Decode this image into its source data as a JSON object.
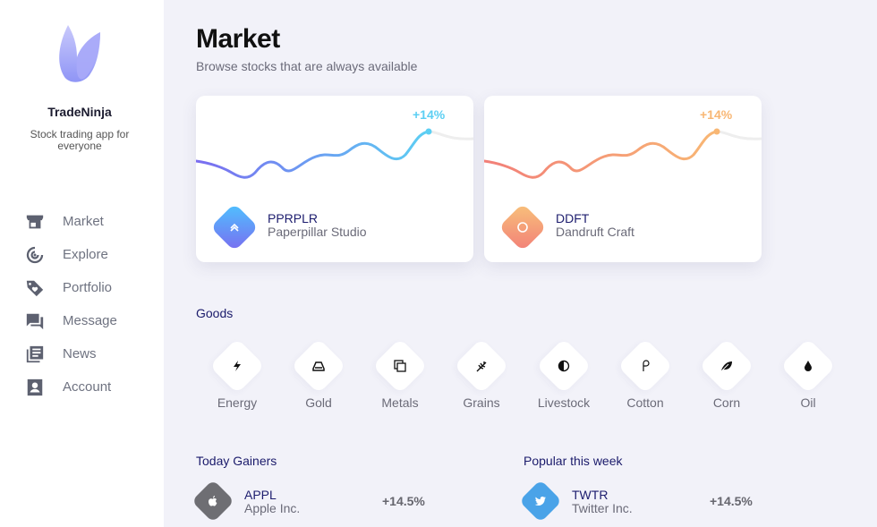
{
  "app": {
    "name": "TradeNinja",
    "tagline": "Stock trading app for everyone"
  },
  "nav": {
    "items": [
      {
        "label": "Market",
        "icon": "store-icon"
      },
      {
        "label": "Explore",
        "icon": "target-icon"
      },
      {
        "label": "Portfolio",
        "icon": "tag-heart-icon"
      },
      {
        "label": "Message",
        "icon": "chat-icon"
      },
      {
        "label": "News",
        "icon": "news-icon"
      },
      {
        "label": "Account",
        "icon": "account-icon"
      }
    ]
  },
  "page": {
    "title": "Market",
    "subtitle": "Browse stocks that are always available"
  },
  "featured": [
    {
      "ticker": "PPRPLR",
      "name": "Paperpillar Studio",
      "change": "+14%",
      "icon": "chevrons-up-icon",
      "colors": [
        "#7a6cf0",
        "#5ccff3"
      ]
    },
    {
      "ticker": "DDFT",
      "name": "Dandruft Craft",
      "change": "+14%",
      "icon": "circle-icon",
      "colors": [
        "#f27f78",
        "#f8b774"
      ]
    }
  ],
  "goods": {
    "title": "Goods",
    "items": [
      {
        "label": "Energy",
        "icon": "lightning-icon"
      },
      {
        "label": "Gold",
        "icon": "ingot-icon"
      },
      {
        "label": "Metals",
        "icon": "copy-icon"
      },
      {
        "label": "Grains",
        "icon": "wheat-icon"
      },
      {
        "label": "Livestock",
        "icon": "half-circle-icon"
      },
      {
        "label": "Cotton",
        "icon": "cotton-icon"
      },
      {
        "label": "Corn",
        "icon": "leaf-icon"
      },
      {
        "label": "Oil",
        "icon": "drop-icon"
      }
    ]
  },
  "gainers": {
    "title": "Today Gainers",
    "items": [
      {
        "ticker": "APPL",
        "name": "Apple Inc.",
        "change": "+14.5%",
        "icon": "apple-icon",
        "color": "#6e6e73"
      }
    ]
  },
  "popular": {
    "title": "Popular this week",
    "items": [
      {
        "ticker": "TWTR",
        "name": "Twitter Inc.",
        "change": "+14.5%",
        "icon": "twitter-icon",
        "color": "#4aa3e8"
      }
    ]
  }
}
